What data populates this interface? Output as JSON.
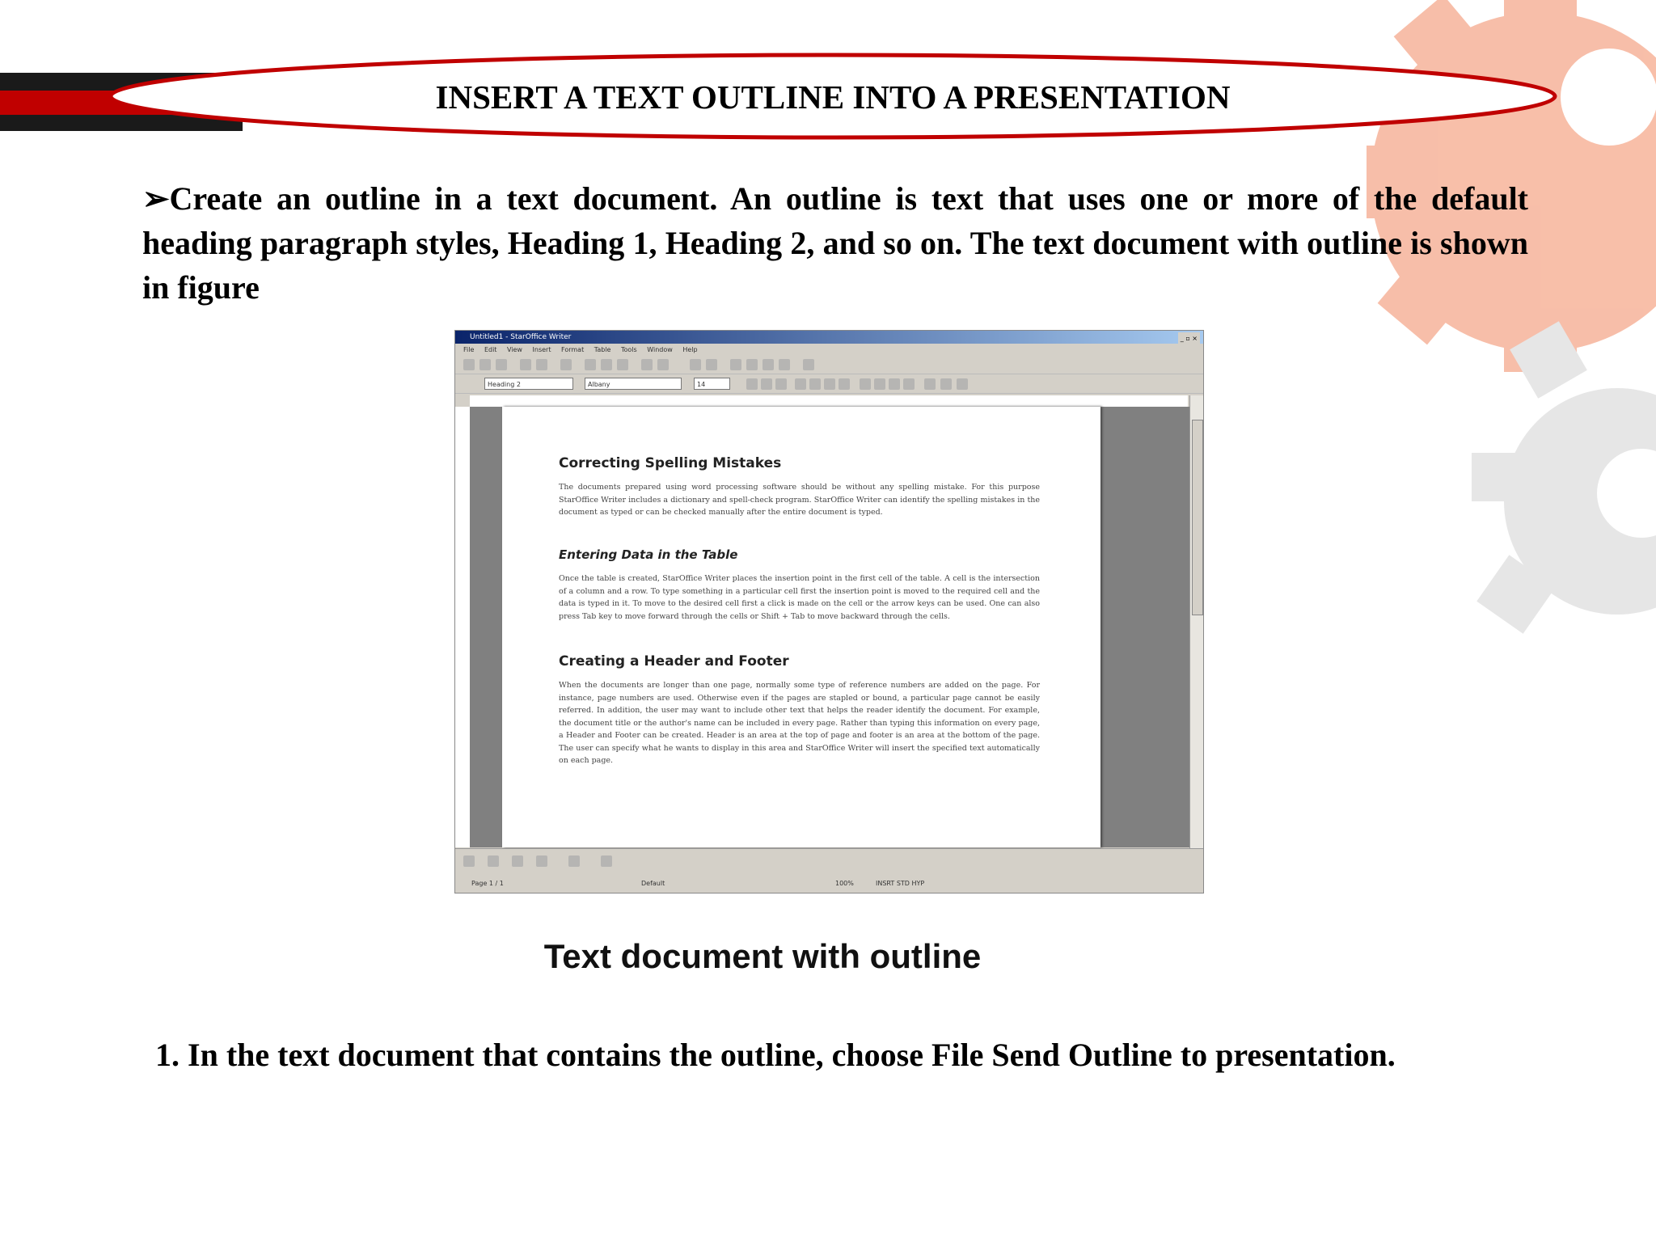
{
  "slide": {
    "title": "INSERT A TEXT OUTLINE INTO A PRESENTATION",
    "intro_bullet": "➢",
    "intro": "Create an outline in a text document. An outline is text that uses one or more of the default heading paragraph styles, Heading 1, Heading 2, and so on. The text document with outline is shown in figure",
    "caption": "Text document with outline",
    "step": "1. In the text document that contains the outline, choose File Send  Outline to presentation."
  },
  "figure": {
    "window_title": "Untitled1 - StarOffice Writer",
    "window_controls": "_ ▫ ×",
    "menu_items": [
      "File",
      "Edit",
      "View",
      "Insert",
      "Format",
      "Table",
      "Tools",
      "Window",
      "Help"
    ],
    "style_box": "Heading 2",
    "font_box": "Albany",
    "size_box": "14",
    "status_page": "Page 1 / 1",
    "status_style": "Default",
    "status_zoom": "100%",
    "status_mode": "INSRT  STD  HYP",
    "doc": {
      "h1": "Correcting Spelling Mistakes",
      "p1": "The documents prepared using word processing software should be without any spelling mistake. For this purpose StarOffice Writer includes a dictionary and spell-check program. StarOffice Writer can identify the spelling mistakes in the document as typed or can be checked manually after the entire document is typed.",
      "h2": "Entering Data in the Table",
      "p2": "Once the table is created, StarOffice Writer places the insertion point in the first cell of the table. A cell is the intersection of a column and a row. To type something in a particular cell first the insertion point is moved to the required cell and the data is typed in it. To move to the desired cell first a click is made on the cell or the arrow keys can be used. One can also press Tab key to move forward through the cells or Shift + Tab to move backward through the cells.",
      "h3": "Creating a Header and Footer",
      "p3": "When the documents are longer than one page, normally some type of reference numbers are added on the page. For instance, page numbers are used. Otherwise even if the pages are stapled or bound, a particular page cannot be easily referred. In addition, the user may want to include other text that helps the reader identify the document. For example, the document title or the author's name can be included in every page. Rather than typing this information on every page, a Header and Footer can be created. Header is an area at the top of page and footer is an area at the bottom of the page. The user can specify what he wants to display in this area and StarOffice Writer will insert the specified text automatically on each page."
    }
  },
  "colors": {
    "accent_red": "#c00000",
    "gear_salmon": "#f7b8a0",
    "gear_gray": "#e6e6e6"
  }
}
